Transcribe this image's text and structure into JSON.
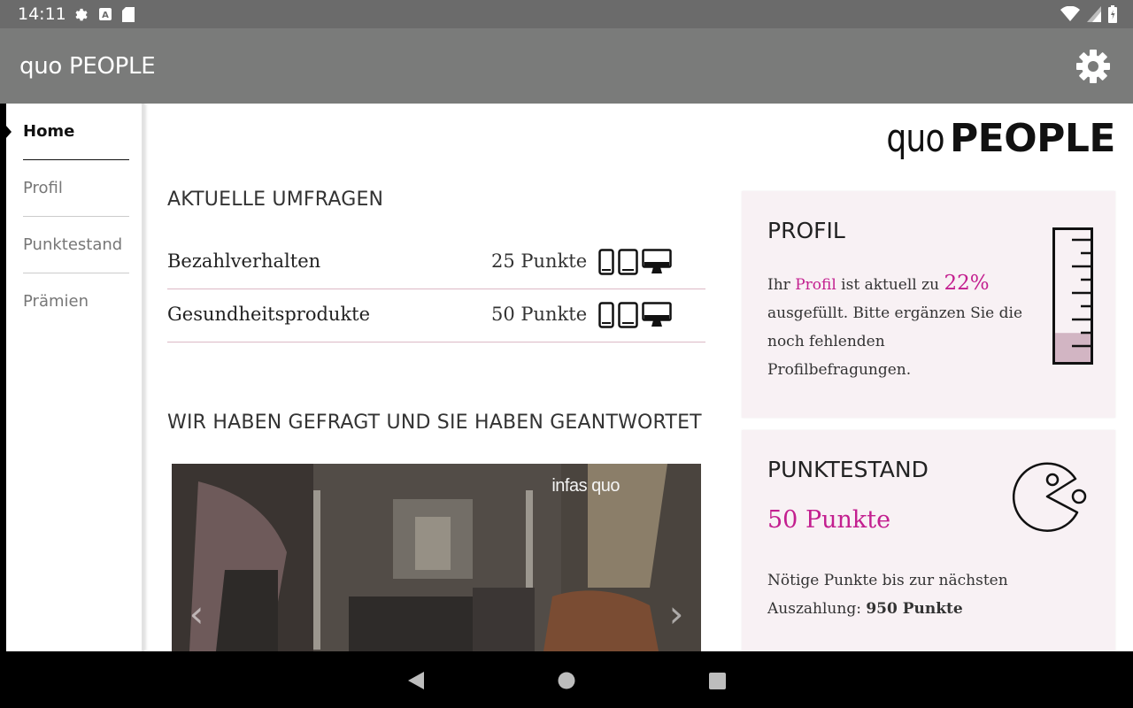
{
  "status_bar": {
    "time": "14:11",
    "icons": [
      "settings-icon",
      "font-icon",
      "sd-card-icon",
      "wifi-icon",
      "signal-icon",
      "battery-icon"
    ]
  },
  "app_bar": {
    "title": "quo PEOPLE",
    "settings_icon": "gear-icon"
  },
  "sidebar": {
    "items": [
      {
        "label": "Home",
        "active": true
      },
      {
        "label": "Profil",
        "active": false
      },
      {
        "label": "Punktestand",
        "active": false
      },
      {
        "label": "Prämien",
        "active": false
      }
    ]
  },
  "logo": {
    "quo": "quo",
    "people": "PEOPLE"
  },
  "surveys": {
    "title": "AKTUELLE UMFRAGEN",
    "items": [
      {
        "name": "Bezahlverhalten",
        "points": "25 Punkte",
        "devices": [
          "smartphone-icon",
          "tablet-icon",
          "desktop-icon"
        ]
      },
      {
        "name": "Gesundheitsprodukte",
        "points": "50 Punkte",
        "devices": [
          "smartphone-icon",
          "tablet-icon",
          "desktop-icon"
        ]
      }
    ]
  },
  "answered": {
    "title": "WIR HABEN GEFRAGT UND SIE HABEN GEANTWORTET",
    "carousel_brand": "infas quo",
    "prev_icon": "chevron-left-icon",
    "next_icon": "chevron-right-icon"
  },
  "profil_card": {
    "title": "PROFIL",
    "text_before": "Ihr ",
    "link": "Profil",
    "text_mid": " ist aktuell zu ",
    "percent": "22%",
    "text_after": "ausgefüllt. Bitte ergänzen Sie die noch fehlenden Profilbefragungen.",
    "completion_fraction": 0.22,
    "icon": "measuring-cylinder-icon"
  },
  "punkte_card": {
    "title": "PUNKTESTAND",
    "points": "50 Punkte",
    "needed_text": "Nötige Punkte bis zur nächsten Auszahlung: ",
    "needed_points": "950 Punkte",
    "icon": "pacman-icon"
  },
  "nav_bar": {
    "buttons": [
      "back-icon",
      "home-icon",
      "recents-icon"
    ]
  },
  "colors": {
    "accent": "#c31f8f",
    "card_bg": "#f8f1f4",
    "app_bar": "#7a7b7a",
    "status_bar": "#6b6b6b"
  }
}
